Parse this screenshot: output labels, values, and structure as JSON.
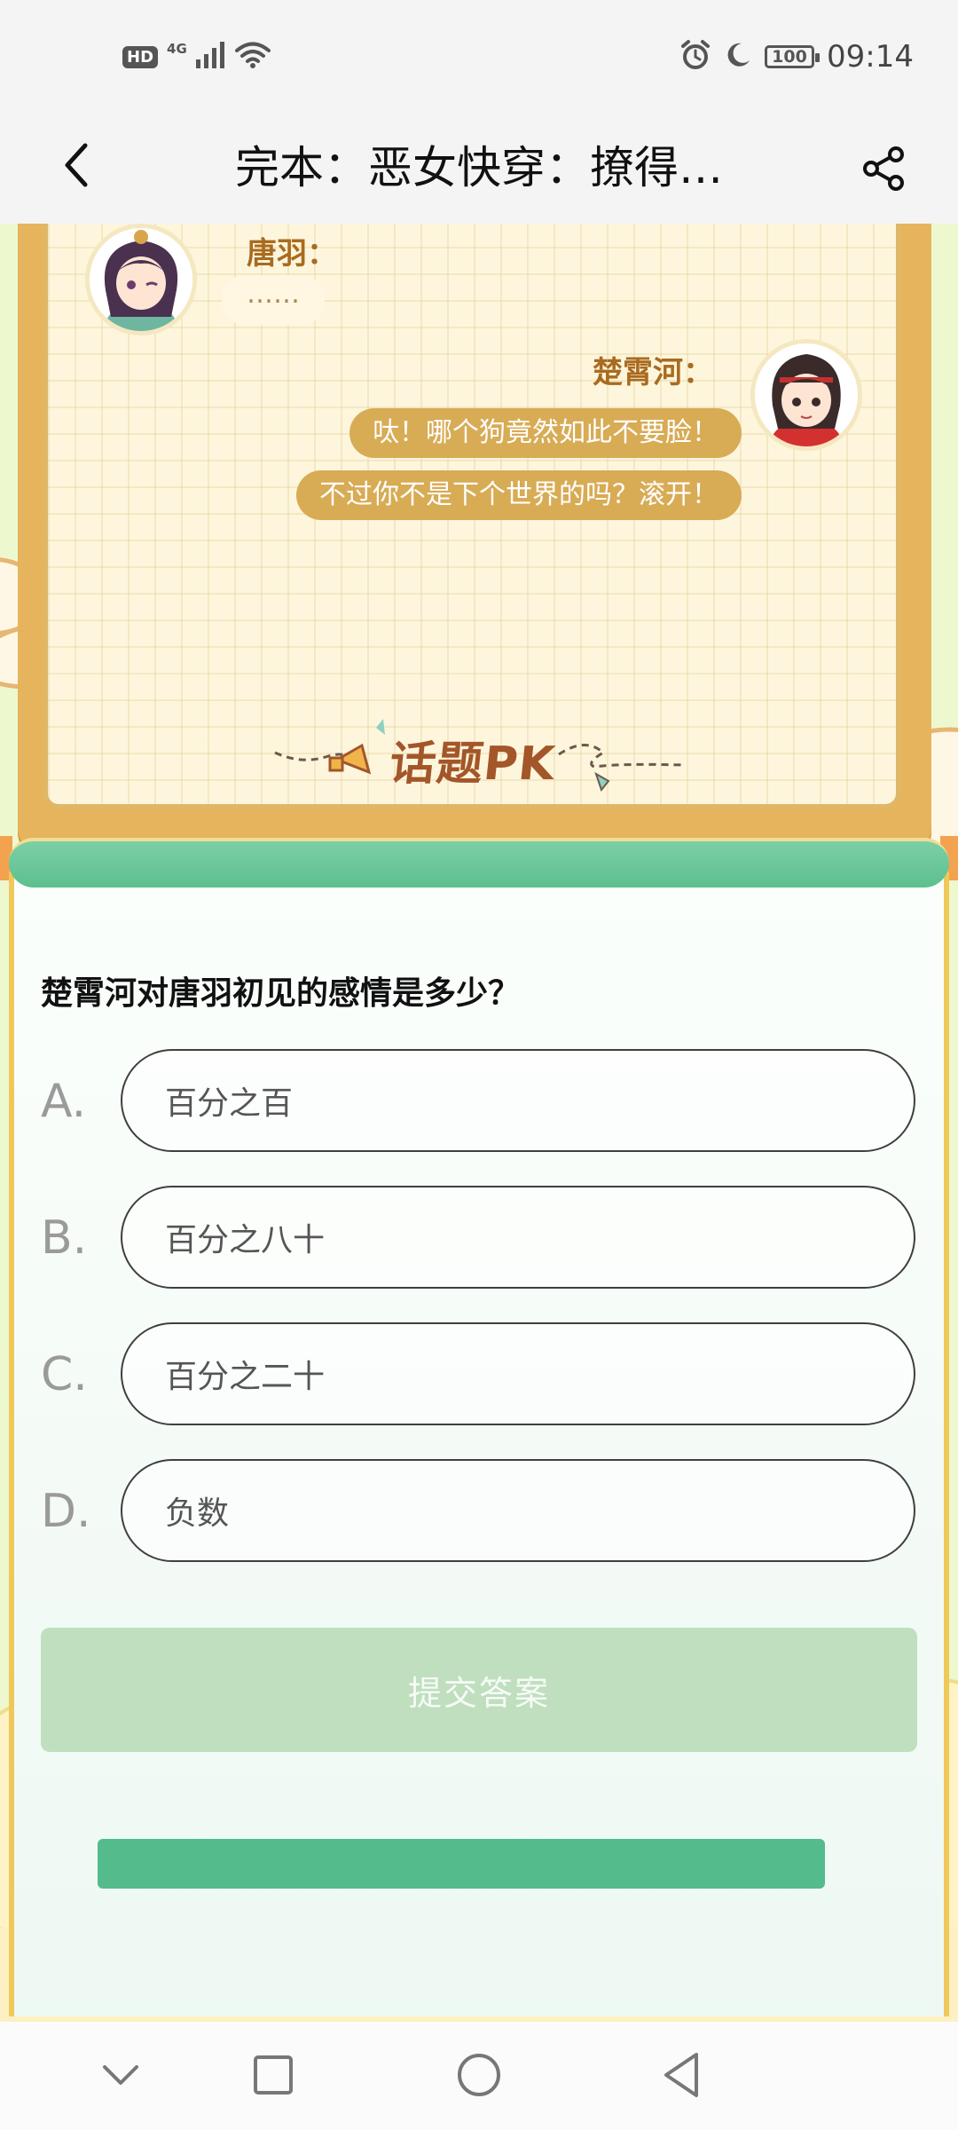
{
  "status_bar": {
    "hd_label": "HD",
    "network_label": "4G",
    "battery_level": "100",
    "time": "09:14"
  },
  "header": {
    "title": "完本：恶女快穿：撩得…"
  },
  "dialogue": {
    "speaker1_name": "唐羽：",
    "speaker1_message": "……",
    "speaker2_name": "楚霄河：",
    "speaker2_messages": [
      "呔！哪个狗竟然如此不要脸！",
      "不过你不是下个世界的吗？滚开！"
    ]
  },
  "section": {
    "title": "话题PK"
  },
  "quiz": {
    "question": "楚霄河对唐羽初见的感情是多少？",
    "options": [
      {
        "letter": "A.",
        "text": "百分之百"
      },
      {
        "letter": "B.",
        "text": "百分之八十"
      },
      {
        "letter": "C.",
        "text": "百分之二十"
      },
      {
        "letter": "D.",
        "text": "负数"
      }
    ],
    "submit_label": "提交答案"
  },
  "colors": {
    "page_bg": "#eef8cf",
    "board_gold": "#e5b45c",
    "bubble_gold": "#d8ab55",
    "card_green": "#5dbf8f",
    "submit_disabled": "#bfdfbf"
  },
  "icons": {
    "back": "chevron-left-icon",
    "share": "share-icon",
    "nav_down": "chevron-down-icon",
    "nav_recent": "square-icon",
    "nav_home": "circle-icon",
    "nav_back": "triangle-back-icon"
  }
}
